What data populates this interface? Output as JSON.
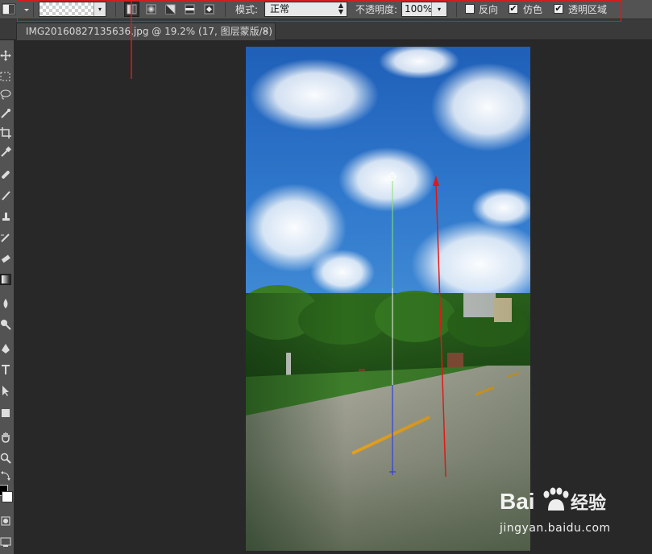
{
  "document": {
    "tab_title": "IMG20160827135636.jpg @ 19.2% (17, 图层蒙版/8) *",
    "close_glyph": "×"
  },
  "options_bar": {
    "mode_label": "模式:",
    "mode_value": "正常",
    "opacity_label": "不透明度:",
    "opacity_value": "100%",
    "reverse_label": "反向",
    "reverse_checked": false,
    "dither_label": "仿色",
    "dither_checked": true,
    "transparency_label": "透明区域",
    "transparency_checked": true,
    "gradient_types": [
      "linear-gradient-icon",
      "radial-gradient-icon",
      "angle-gradient-icon",
      "reflected-gradient-icon",
      "diamond-gradient-icon"
    ],
    "active_gradient_type": 0
  },
  "watermark": {
    "brand": "Bai",
    "brand_suffix": "经验",
    "url": "jingyan.baidu.com"
  },
  "colors": {
    "annotation_red": "#e01818",
    "panel_bg": "#535353",
    "canvas_bg": "#282828"
  }
}
